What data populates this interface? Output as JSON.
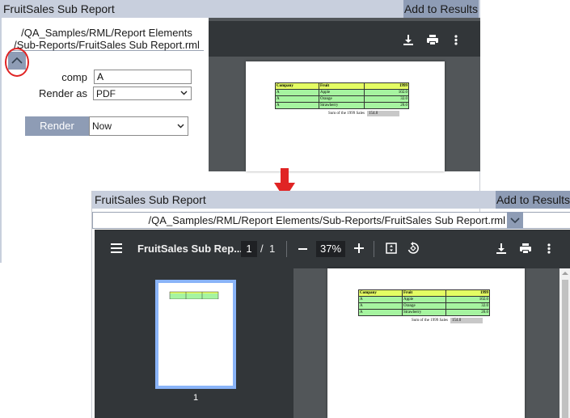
{
  "top": {
    "title": "FruitSales Sub Report",
    "add_to_results": "Add to Results",
    "path_line1": "/QA_Samples/RML/Report Elements",
    "path_line2": "/Sub-Reports/FruitSales Sub Report.rml",
    "params": {
      "comp_label": "comp",
      "comp_value": "A",
      "render_as_label": "Render as",
      "render_as_value": "PDF"
    },
    "render_button": "Render",
    "schedule_value": "Now"
  },
  "bottom": {
    "title": "FruitSales Sub Report",
    "add_to_results": "Add to Results",
    "path": "/QA_Samples/RML/Report Elements/Sub-Reports/FruitSales Sub Report.rml",
    "viewer": {
      "doc_title": "FruitSales Sub Rep...",
      "current_page": "1",
      "page_separator": "/",
      "total_pages": "1",
      "zoom": "37%",
      "thumbnail_page_number": "1"
    }
  },
  "report": {
    "headers": [
      "Company",
      "Fruit",
      "1999"
    ],
    "rows": [
      [
        "A",
        "Apple",
        "102.0"
      ],
      [
        "A",
        "Orange",
        "32.0"
      ],
      [
        "A",
        "Strawberry",
        "20.0"
      ]
    ],
    "sum_label": "Sum of the 1999 Sales",
    "sum_value": "154.0"
  },
  "colors": {
    "header_bg": "#c8cfdd",
    "button_bg": "#8e9cb5",
    "viewer_toolbar": "#323639",
    "viewer_bg": "#525659",
    "table_header": "#e4fd63",
    "table_row": "#a6f4a0",
    "annotation": "#e02424"
  },
  "icons": [
    "chevron-up-icon",
    "chevron-down-icon",
    "download-icon",
    "print-icon",
    "more-vert-icon",
    "menu-icon",
    "plus-icon",
    "minus-icon",
    "fit-page-icon",
    "rotate-icon",
    "arrow-down-icon"
  ]
}
